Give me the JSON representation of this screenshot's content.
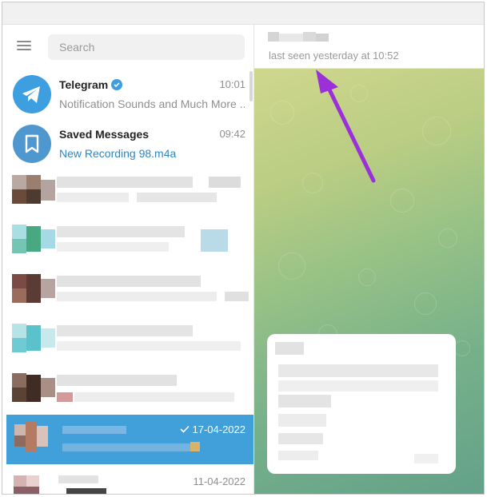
{
  "search": {
    "placeholder": "Search"
  },
  "chats": [
    {
      "name": "Telegram",
      "time": "10:01",
      "preview": "Notification Sounds and Much More ...",
      "verified": true,
      "avatar_icon": "paper-plane-icon"
    },
    {
      "name": "Saved Messages",
      "time": "09:42",
      "preview": "New Recording 98.m4a",
      "avatar_icon": "bookmark-icon"
    }
  ],
  "active_chat": {
    "time": "17-04-2022",
    "status_icon": "checkmark-icon"
  },
  "last_chat": {
    "time": "11-04-2022"
  },
  "conversation": {
    "last_seen": "last seen yesterday at 10:52"
  },
  "colors": {
    "accent": "#419fd9",
    "link": "#2f86c0",
    "arrow": "#9b30d9"
  }
}
